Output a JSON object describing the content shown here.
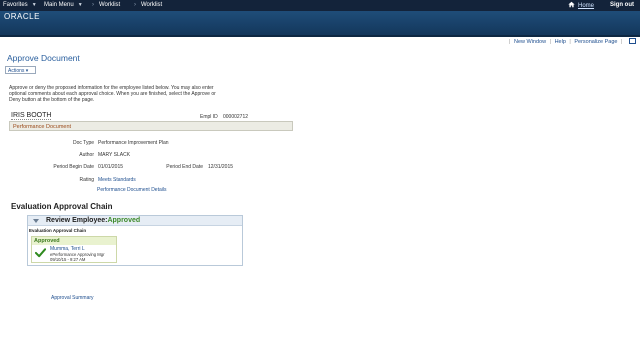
{
  "nav": {
    "favorites": "Favorites",
    "main_menu": "Main Menu",
    "worklist1": "Worklist",
    "worklist2": "Worklist",
    "home": "Home",
    "sign_out": "Sign out"
  },
  "brand": {
    "logo": "ORACLE"
  },
  "pagebar": {
    "new_window": "New Window",
    "help": "Help",
    "personalize": "Personalize Page"
  },
  "page": {
    "title": "Approve Document",
    "actions_label": "Actions ▾",
    "instructions": "Approve or deny the proposed information for the employee listed below. You may also enter optional comments about each approval choice. When you are finished, select the Approve or Deny button at the bottom of the page."
  },
  "employee": {
    "name": "IRIS BOOTH",
    "empl_id_label": "Empl ID",
    "empl_id": "000002712",
    "section": "Performance Document"
  },
  "document": {
    "doc_type_label": "Doc Type",
    "doc_type": "Performance Improvement Plan",
    "author_label": "Author",
    "author": "MARY SLACK",
    "begin_label": "Period Begin Date",
    "begin": "01/01/2015",
    "end_label": "Period End Date",
    "end": "12/31/2015",
    "rating_label": "Rating",
    "rating": "Meets Standards",
    "details_link": "Performance Document Details"
  },
  "chain": {
    "title": "Evaluation Approval Chain",
    "review_label": "Review Employee:",
    "review_status": "Approved",
    "sub_title": "Evaluation Approval Chain",
    "card_status": "Approved",
    "approver_name": "Mumma, Terri L",
    "approver_role": "ePerformance Approving Mgr",
    "approver_date": "09/10/15 - 9:27 AM"
  },
  "footer": {
    "approval_summary": "Approval Summary"
  },
  "colors": {
    "nav_bg": "#13233a",
    "banner": "#1f4d79",
    "link": "#1f4f8f",
    "approved": "#3d8a2a"
  }
}
